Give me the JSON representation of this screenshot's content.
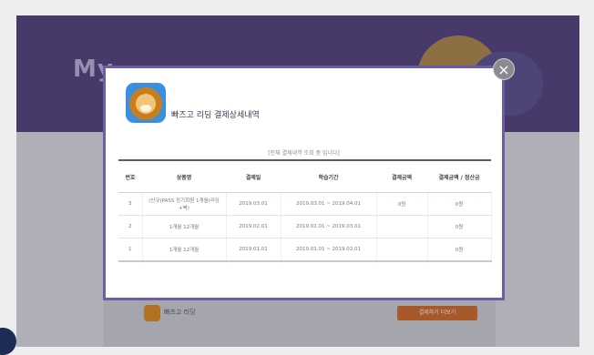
{
  "background": {
    "hero_title": "My"
  },
  "modal": {
    "title": "빠즈고 리딩 결제상세내역",
    "close_label": "×",
    "period": "[전체 결제내역 조회 중 입니다]",
    "columns": [
      "번호",
      "상품명",
      "결제일",
      "학습기간",
      "결제금액",
      "결제금액 / 정산금"
    ],
    "rows": [
      [
        "3",
        "(신규)PASS 정기회원 1개월(리딩+북)",
        "2019.03.01",
        "2019.03.01 ~ 2019.04.01",
        "0원",
        "0원"
      ],
      [
        "2",
        "1개월 12개월",
        "2019.02.01",
        "2019.02.01 ~ 2019.03.01",
        "",
        "0원"
      ],
      [
        "1",
        "1개월 12개월",
        "2019.01.01",
        "2019.01.01 ~ 2019.02.01",
        "",
        "0원"
      ]
    ]
  },
  "bottom": {
    "app_name": "빠즈고 리딩",
    "button_label": "결제하기 더보기"
  },
  "colors": {
    "hero": "#52407d",
    "modal_border": "#6b5da6",
    "button": "#d36a2a"
  }
}
